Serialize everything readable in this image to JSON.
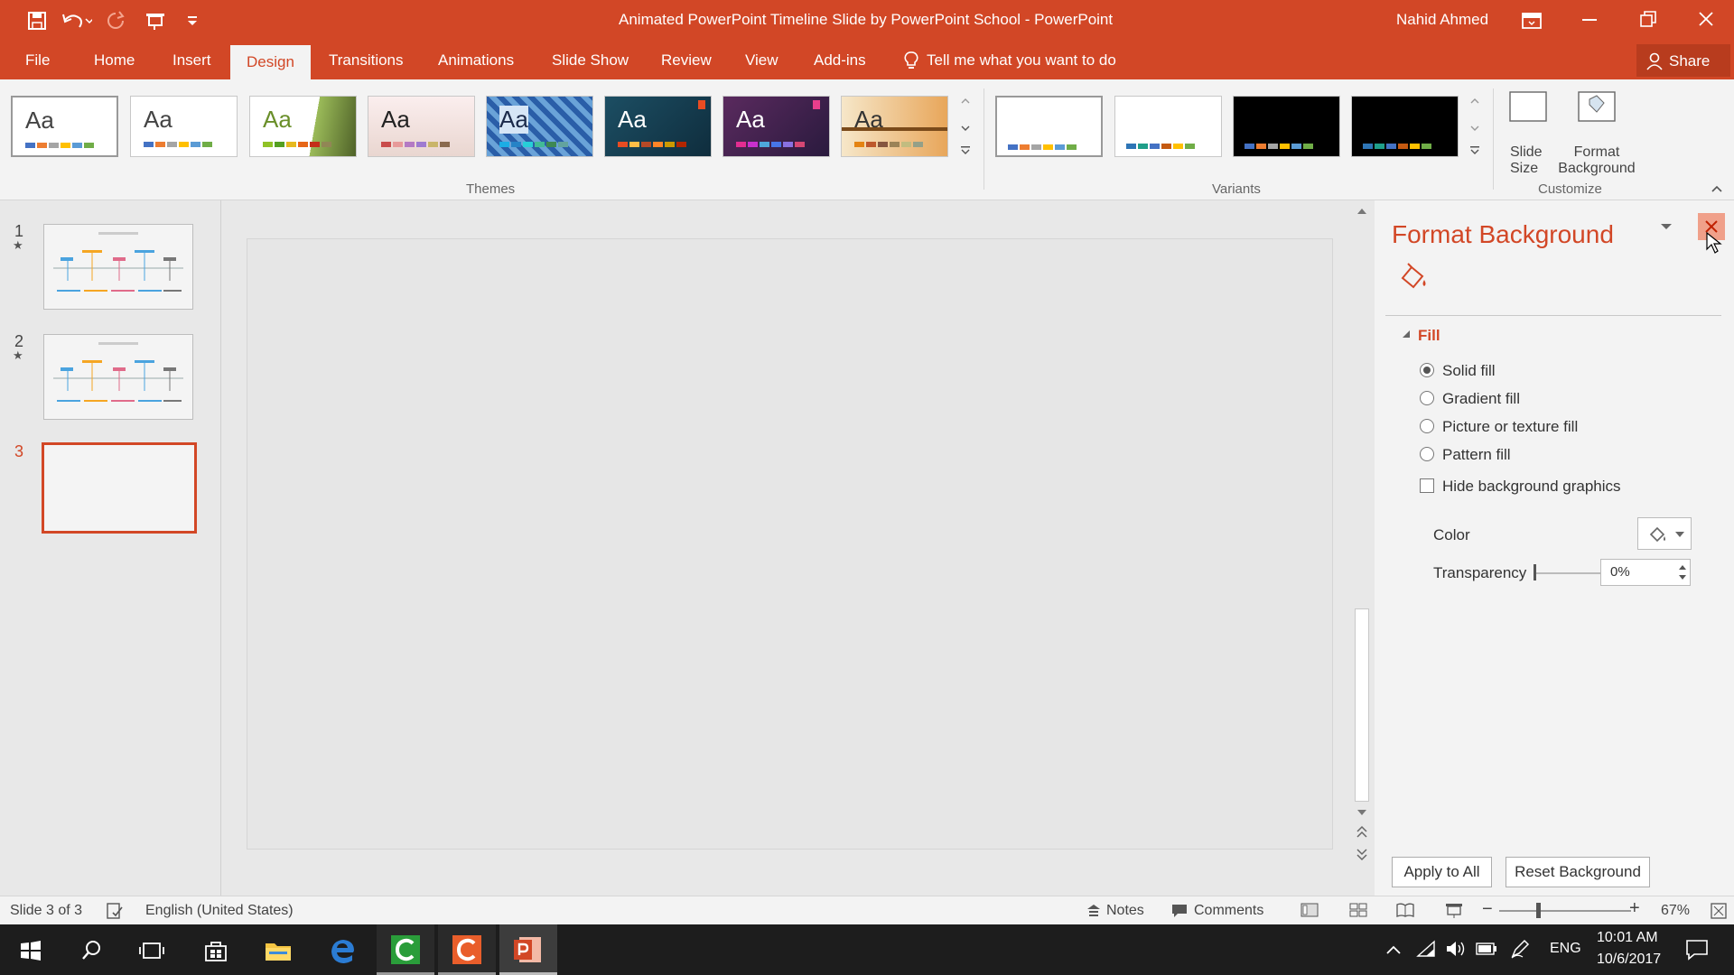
{
  "window": {
    "title": "Animated PowerPoint Timeline Slide by PowerPoint School  -  PowerPoint",
    "user": "Nahid Ahmed"
  },
  "tabs": [
    "File",
    "Home",
    "Insert",
    "Design",
    "Transitions",
    "Animations",
    "Slide Show",
    "Review",
    "View",
    "Add-ins"
  ],
  "active_tab": "Design",
  "tell_me": "Tell me what you want to do",
  "share": "Share",
  "ribbon": {
    "themes_label": "Themes",
    "variants_label": "Variants",
    "customize_label": "Customize",
    "theme_aa": "Aa",
    "slide_size": "Slide Size",
    "format_background": "Format Background"
  },
  "slides": {
    "n1": "1",
    "n2": "2",
    "n3": "3"
  },
  "pane": {
    "title": "Format Background",
    "fill_section": "Fill",
    "solid": "Solid fill",
    "gradient": "Gradient fill",
    "picture": "Picture or texture fill",
    "pattern": "Pattern fill",
    "hide_bg": "Hide background graphics",
    "color": "Color",
    "transparency": "Transparency",
    "transparency_value": "0%",
    "apply_all": "Apply to All",
    "reset": "Reset Background"
  },
  "status": {
    "slide": "Slide 3 of 3",
    "language": "English (United States)",
    "notes": "Notes",
    "comments": "Comments",
    "zoom": "67%"
  },
  "taskbar": {
    "time": "10:01 AM",
    "date": "10/6/2017",
    "lang": "ENG"
  },
  "colors": {
    "accent": "#d24726",
    "ribbon": "#f3f3f3",
    "taskbar": "#1d1d1d"
  }
}
